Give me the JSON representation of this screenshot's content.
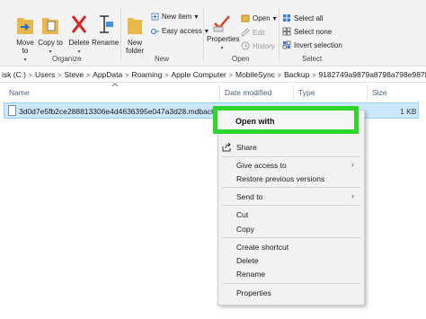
{
  "ribbon": {
    "organize": {
      "label": "Organize",
      "move_to": "Move to",
      "copy_to": "Copy to",
      "delete": "Delete",
      "rename": "Rename"
    },
    "new": {
      "label": "New",
      "new_folder_line1": "New",
      "new_folder_line2": "folder",
      "new_item": "New item",
      "easy_access": "Easy access"
    },
    "open": {
      "label": "Open",
      "properties": "Properties",
      "open": "Open",
      "edit": "Edit",
      "history": "History"
    },
    "select": {
      "label": "Select",
      "select_all": "Select all",
      "select_none": "Select none",
      "invert_selection": "Invert selection"
    }
  },
  "address": {
    "crumbs": [
      "isk (C:)",
      "Users",
      "Steve",
      "AppData",
      "Roaming",
      "Apple Computer",
      "MobileSync",
      "Backup",
      "9182749a9879a8798a798e987f"
    ]
  },
  "columns": {
    "name": "Name",
    "date_modified": "Date modified",
    "type": "Type",
    "size": "Size"
  },
  "file": {
    "name": "3d0d7e5fb2ce288813306e4d4636395e047a3d28.mdbackup",
    "size": "1 KB"
  },
  "context_menu": {
    "open_with": "Open with",
    "share": "Share",
    "give_access_to": "Give access to",
    "restore_previous_versions": "Restore previous versions",
    "send_to": "Send to",
    "cut": "Cut",
    "copy": "Copy",
    "create_shortcut": "Create shortcut",
    "delete": "Delete",
    "rename": "Rename",
    "properties": "Properties"
  },
  "colors": {
    "highlight": "#2dd82b",
    "selection": "#cce8ff",
    "ribbon": "#f3f3f3"
  }
}
